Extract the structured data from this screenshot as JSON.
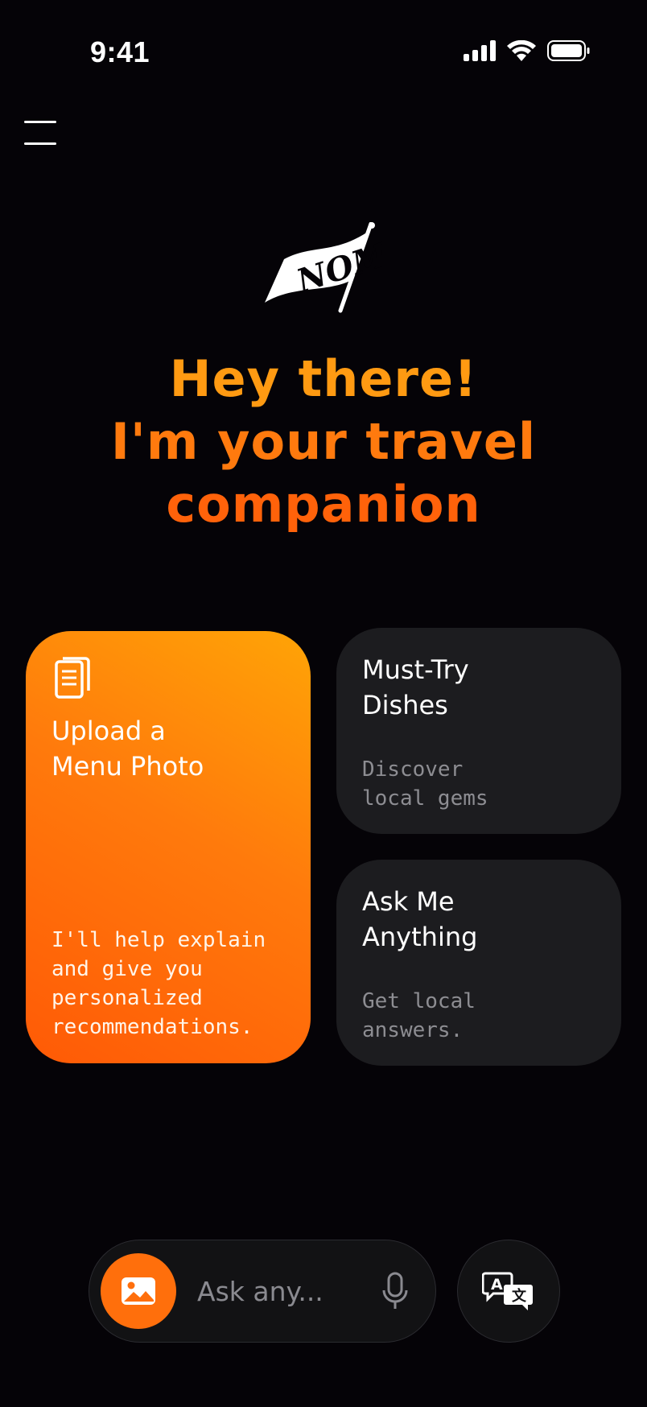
{
  "status_bar": {
    "time": "9:41"
  },
  "header": {
    "menu_icon": "hamburger-menu-icon",
    "logo_text": "NOM"
  },
  "headline": {
    "line1": "Hey there!",
    "line2": "I'm your travel",
    "line3": "companion"
  },
  "cards": {
    "upload": {
      "icon": "document-icon",
      "title": "Upload a\nMenu Photo",
      "subtitle": "I'll help explain\nand give you\npersonalized\nrecommendations."
    },
    "dishes": {
      "title": "Must-Try\nDishes",
      "subtitle": "Discover\nlocal gems"
    },
    "ask": {
      "title": "Ask Me\nAnything",
      "subtitle": "Get local\nanswers."
    }
  },
  "bottom_bar": {
    "image_icon": "image-icon",
    "search_placeholder": "Ask any...",
    "mic_icon": "microphone-icon",
    "translate_icon": "translate-icon"
  },
  "colors": {
    "background": "#050307",
    "accent": "#ff7a0e",
    "card_dark": "#1c1c1f"
  }
}
